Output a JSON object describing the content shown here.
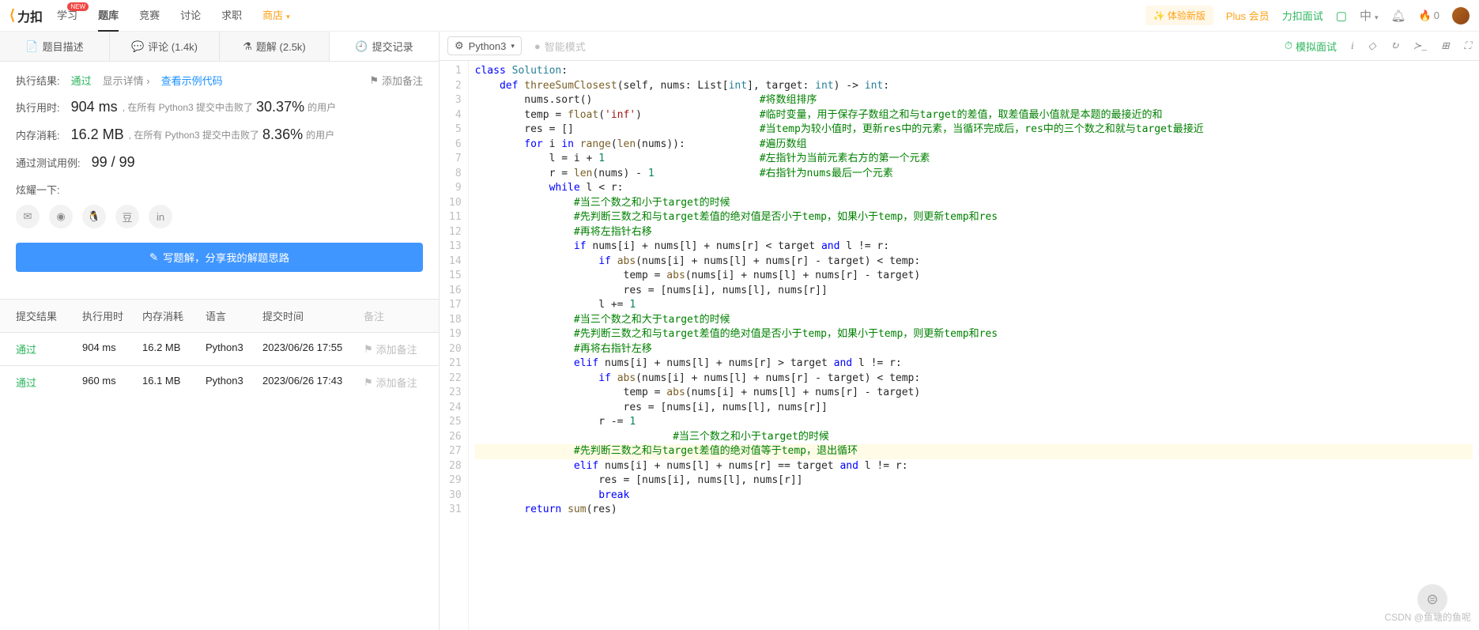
{
  "header": {
    "logo": "力扣",
    "nav": [
      "学习",
      "题库",
      "竞赛",
      "讨论",
      "求职",
      "商店"
    ],
    "active_nav": "题库",
    "badge_on": "学习",
    "new_version": "✨ 体验新版",
    "plus": "Plus 会员",
    "interview": "力扣面试",
    "lang_switch": "中",
    "fire_count": "0"
  },
  "left_tabs": {
    "description": "题目描述",
    "comments": "评论 (1.4k)",
    "solutions": "题解 (2.5k)",
    "submissions": "提交记录"
  },
  "result": {
    "label_result": "执行结果:",
    "pass": "通过",
    "show_detail": "显示详情 ›",
    "show_example": "查看示例代码",
    "add_note": "添加备注",
    "label_runtime": "执行用时:",
    "runtime": "904 ms",
    "runtime_text1": ", 在所有 Python3 提交中击败了",
    "runtime_pct": "30.37%",
    "label_memory": "内存消耗:",
    "memory": "16.2 MB",
    "memory_text1": ", 在所有 Python3 提交中击败了",
    "memory_pct": "8.36%",
    "users_suffix": "的用户",
    "label_cases": "通过测试用例:",
    "cases": "99 / 99",
    "share_label": "炫耀一下:",
    "write_solution": "写题解，分享我的解题思路"
  },
  "history": {
    "headers": {
      "result": "提交结果",
      "time": "执行用时",
      "mem": "内存消耗",
      "lang": "语言",
      "date": "提交时间",
      "note": "备注"
    },
    "rows": [
      {
        "result": "通过",
        "time": "904 ms",
        "mem": "16.2 MB",
        "lang": "Python3",
        "date": "2023/06/26 17:55",
        "note": "添加备注"
      },
      {
        "result": "通过",
        "time": "960 ms",
        "mem": "16.1 MB",
        "lang": "Python3",
        "date": "2023/06/26 17:43",
        "note": "添加备注"
      }
    ]
  },
  "toolbar": {
    "language": "Python3",
    "smart": "智能模式",
    "mock": "模拟面试"
  },
  "watermark": "CSDN @鱼塘的鱼呢",
  "code_lines": [
    [
      [
        "kw",
        "class"
      ],
      [
        "",
        " "
      ],
      [
        "cls",
        "Solution"
      ],
      [
        "",
        ":"
      ]
    ],
    [
      [
        "",
        "    "
      ],
      [
        "kw",
        "def"
      ],
      [
        "",
        " "
      ],
      [
        "fn",
        "threeSumClosest"
      ],
      [
        "",
        "(self, nums: List["
      ],
      [
        "cls",
        "int"
      ],
      [
        "",
        "], target: "
      ],
      [
        "cls",
        "int"
      ],
      [
        "",
        ") -> "
      ],
      [
        "cls",
        "int"
      ],
      [
        "",
        ":"
      ]
    ],
    [
      [
        "",
        "        nums.sort()                           "
      ],
      [
        "cmt",
        "#将数组排序"
      ]
    ],
    [
      [
        "",
        "        temp = "
      ],
      [
        "fn",
        "float"
      ],
      [
        "",
        "("
      ],
      [
        "str",
        "'inf'"
      ],
      [
        "",
        ")                   "
      ],
      [
        "cmt",
        "#临时变量，用于保存子数组之和与target的差值，取差值最小值就是本题的最接近的和"
      ]
    ],
    [
      [
        "",
        "        res = []                              "
      ],
      [
        "cmt",
        "#当temp为较小值时，更新res中的元素，当循环完成后，res中的三个数之和就与target最接近"
      ]
    ],
    [
      [
        "",
        "        "
      ],
      [
        "kw",
        "for"
      ],
      [
        "",
        " i "
      ],
      [
        "kw",
        "in"
      ],
      [
        "",
        " "
      ],
      [
        "fn",
        "range"
      ],
      [
        "",
        "("
      ],
      [
        "fn",
        "len"
      ],
      [
        "",
        "(nums)):            "
      ],
      [
        "cmt",
        "#遍历数组"
      ]
    ],
    [
      [
        "",
        "            l = i + "
      ],
      [
        "num",
        "1"
      ],
      [
        "",
        "                         "
      ],
      [
        "cmt",
        "#左指针为当前元素右方的第一个元素"
      ]
    ],
    [
      [
        "",
        "            r = "
      ],
      [
        "fn",
        "len"
      ],
      [
        "",
        "(nums) - "
      ],
      [
        "num",
        "1"
      ],
      [
        "",
        "                 "
      ],
      [
        "cmt",
        "#右指针为nums最后一个元素"
      ]
    ],
    [
      [
        "",
        "            "
      ],
      [
        "kw",
        "while"
      ],
      [
        "",
        " l < r:"
      ]
    ],
    [
      [
        "",
        "                "
      ],
      [
        "cmt",
        "#当三个数之和小于target的时候"
      ]
    ],
    [
      [
        "",
        "                "
      ],
      [
        "cmt",
        "#先判断三数之和与target差值的绝对值是否小于temp，如果小于temp，则更新temp和res"
      ]
    ],
    [
      [
        "",
        "                "
      ],
      [
        "cmt",
        "#再将左指针右移"
      ]
    ],
    [
      [
        "",
        "                "
      ],
      [
        "kw",
        "if"
      ],
      [
        "",
        " nums[i] + nums[l] + nums[r] < target "
      ],
      [
        "kw",
        "and"
      ],
      [
        "",
        " l != r:"
      ]
    ],
    [
      [
        "",
        "                    "
      ],
      [
        "kw",
        "if"
      ],
      [
        "",
        " "
      ],
      [
        "fn",
        "abs"
      ],
      [
        "",
        "(nums[i] + nums[l] + nums[r] - target) < temp:"
      ]
    ],
    [
      [
        "",
        "                        temp = "
      ],
      [
        "fn",
        "abs"
      ],
      [
        "",
        "(nums[i] + nums[l] + nums[r] - target)"
      ]
    ],
    [
      [
        "",
        "                        res = [nums[i], nums[l], nums[r]]"
      ]
    ],
    [
      [
        "",
        "                    l += "
      ],
      [
        "num",
        "1"
      ]
    ],
    [
      [
        "",
        "                "
      ],
      [
        "cmt",
        "#当三个数之和大于target的时候"
      ]
    ],
    [
      [
        "",
        "                "
      ],
      [
        "cmt",
        "#先判断三数之和与target差值的绝对值是否小于temp，如果小于temp，则更新temp和res"
      ]
    ],
    [
      [
        "",
        "                "
      ],
      [
        "cmt",
        "#再将右指针左移"
      ]
    ],
    [
      [
        "",
        "                "
      ],
      [
        "kw",
        "elif"
      ],
      [
        "",
        " nums[i] + nums[l] + nums[r] > target "
      ],
      [
        "kw",
        "and"
      ],
      [
        "",
        " l != r:"
      ]
    ],
    [
      [
        "",
        "                    "
      ],
      [
        "kw",
        "if"
      ],
      [
        "",
        " "
      ],
      [
        "fn",
        "abs"
      ],
      [
        "",
        "(nums[i] + nums[l] + nums[r] - target) < temp:"
      ]
    ],
    [
      [
        "",
        "                        temp = "
      ],
      [
        "fn",
        "abs"
      ],
      [
        "",
        "(nums[i] + nums[l] + nums[r] - target)"
      ]
    ],
    [
      [
        "",
        "                        res = [nums[i], nums[l], nums[r]]"
      ]
    ],
    [
      [
        "",
        "                    r -= "
      ],
      [
        "num",
        "1"
      ]
    ],
    [
      [
        "",
        "                                "
      ],
      [
        "cmt",
        "#当三个数之和小于target的时候"
      ]
    ],
    [
      [
        "",
        "                "
      ],
      [
        "cmt",
        "#先判断三数之和与target差值的绝对值等于temp，退出循环"
      ]
    ],
    [
      [
        "",
        "                "
      ],
      [
        "kw",
        "elif"
      ],
      [
        "",
        " nums[i] + nums[l] + nums[r] == target "
      ],
      [
        "kw",
        "and"
      ],
      [
        "",
        " l != r:"
      ]
    ],
    [
      [
        "",
        "                    res = [nums[i], nums[l], nums[r]]"
      ]
    ],
    [
      [
        "",
        "                    "
      ],
      [
        "kw",
        "break"
      ]
    ],
    [
      [
        "",
        "        "
      ],
      [
        "kw",
        "return"
      ],
      [
        "",
        " "
      ],
      [
        "fn",
        "sum"
      ],
      [
        "",
        "(res)"
      ]
    ]
  ],
  "highlight_line": 27
}
